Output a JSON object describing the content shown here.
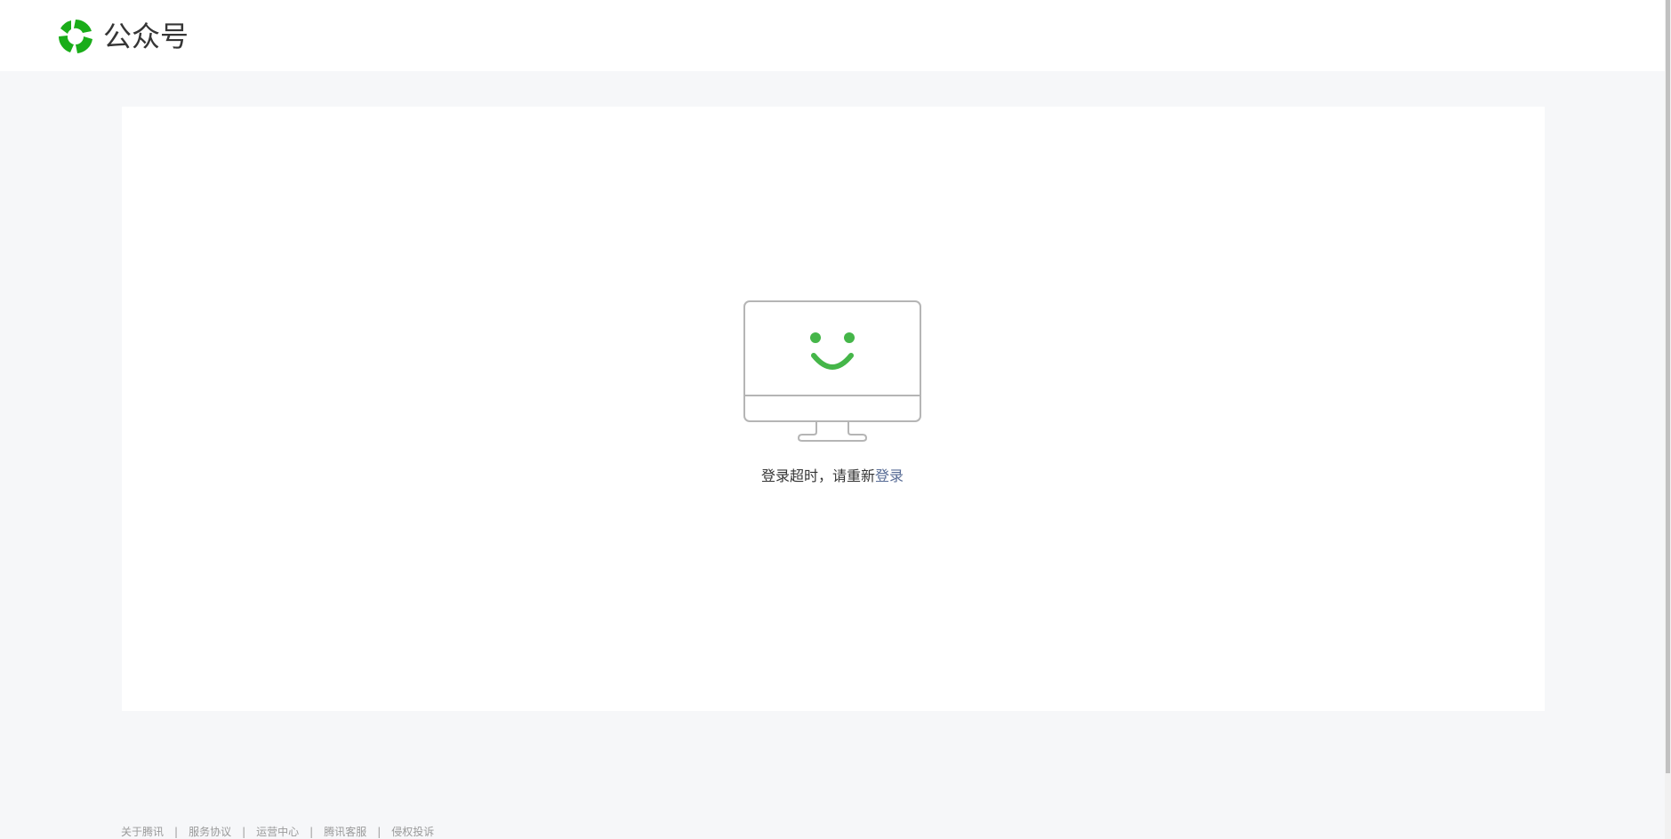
{
  "header": {
    "brand": "公众号",
    "logo_icon": "wechat-official-account-logo-icon",
    "logo_color": "#1aad19"
  },
  "main": {
    "illustration_icon": "smiling-monitor-icon",
    "message_prefix": "登录超时，请重新",
    "login_link": "登录",
    "accent_color": "#45b649",
    "link_color": "#576b95"
  },
  "footer": {
    "links": [
      "关于腾讯",
      "服务协议",
      "运营中心",
      "腾讯客服",
      "侵权投诉"
    ],
    "separator": "|"
  }
}
